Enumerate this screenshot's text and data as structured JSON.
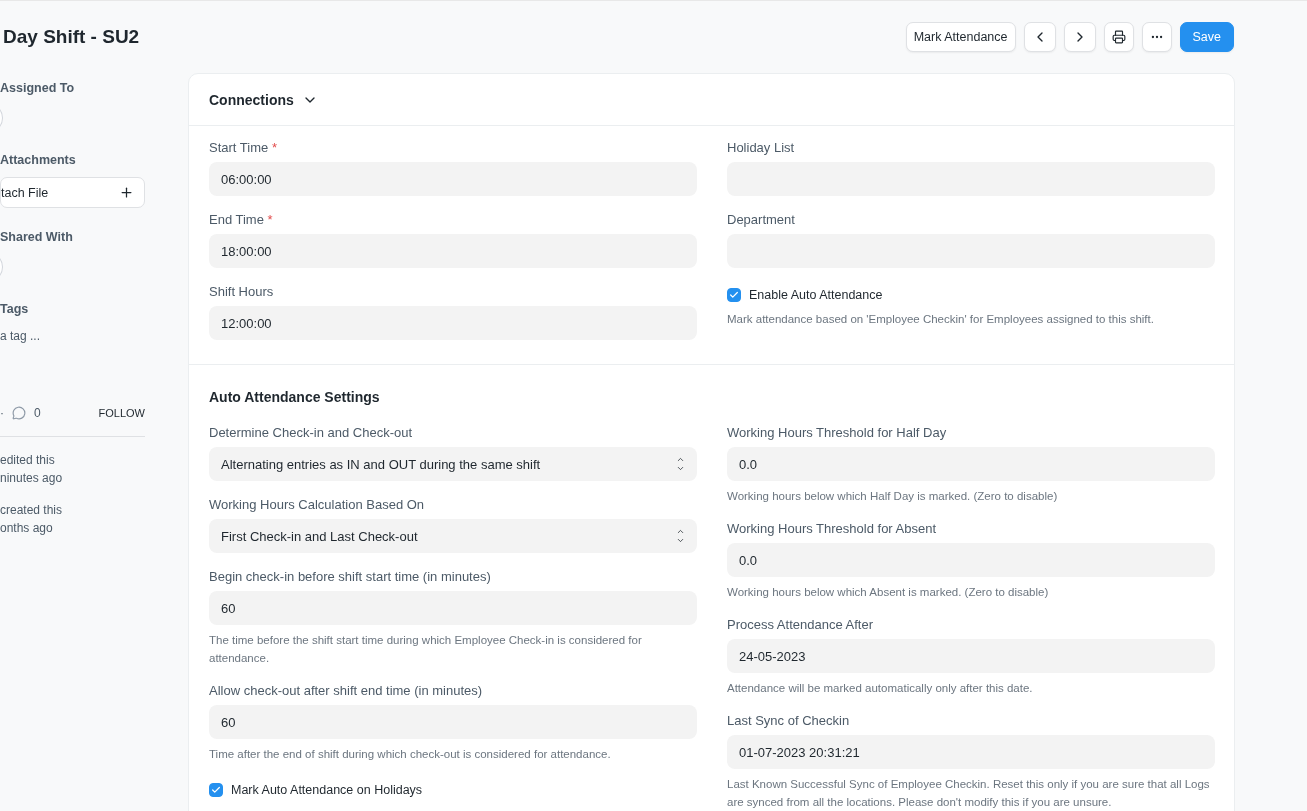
{
  "title": "Day Shift - SU2",
  "actions": {
    "mark": "Mark Attendance",
    "save": "Save"
  },
  "sidebar": {
    "sections": [
      {
        "label": "Assigned To",
        "kind": "avatar"
      },
      {
        "label": "Attachments",
        "kind": "attach",
        "button": "tach File"
      },
      {
        "label": "Shared With",
        "kind": "avatar"
      },
      {
        "label": "Tags",
        "kind": "tags",
        "placeholder": "a tag ..."
      }
    ],
    "dot": "·",
    "comments": "0",
    "follow": "FOLLOW",
    "activity": [
      {
        "line1": "edited this",
        "line2": "ninutes ago"
      },
      {
        "line1": "created this",
        "line2": "onths ago"
      }
    ]
  },
  "required_mark": "*",
  "connections": {
    "title": "Connections",
    "expanded": false
  },
  "sections": [
    {
      "columns": [
        [
          {
            "kind": "input",
            "label": "Start Time",
            "required": true,
            "value": "06:00:00"
          },
          {
            "kind": "input",
            "label": "End Time",
            "required": true,
            "value": "18:00:00"
          },
          {
            "kind": "input",
            "label": "Shift Hours",
            "required": false,
            "value": "12:00:00"
          }
        ],
        [
          {
            "kind": "input",
            "label": "Holiday List",
            "required": false
          },
          {
            "kind": "input",
            "label": "Department",
            "required": false
          },
          {
            "kind": "checkbox",
            "label": "Enable Auto Attendance",
            "checked": true,
            "description": "Mark attendance based on 'Employee Checkin' for Employees assigned to this shift."
          }
        ]
      ]
    },
    {
      "title": "Auto Attendance Settings",
      "columns": [
        [
          {
            "kind": "select",
            "label": "Determine Check-in and Check-out",
            "required": false,
            "value": "Alternating entries as IN and OUT during the same shift"
          },
          {
            "kind": "select",
            "label": "Working Hours Calculation Based On",
            "required": false,
            "value": "First Check-in and Last Check-out"
          },
          {
            "kind": "input",
            "label": "Begin check-in before shift start time (in minutes)",
            "required": false,
            "value": "60",
            "description": "The time before the shift start time during which Employee Check-in is considered for attendance."
          },
          {
            "kind": "input",
            "label": "Allow check-out after shift end time (in minutes)",
            "required": false,
            "value": "60",
            "description": "Time after the end of shift during which check-out is considered for attendance."
          },
          {
            "kind": "checkbox",
            "label": "Mark Auto Attendance on Holidays",
            "checked": true
          }
        ],
        [
          {
            "kind": "input",
            "label": "Working Hours Threshold for Half Day",
            "required": false,
            "value": "0.0",
            "description": "Working hours below which Half Day is marked. (Zero to disable)"
          },
          {
            "kind": "input",
            "label": "Working Hours Threshold for Absent",
            "required": false,
            "value": "0.0",
            "description": "Working hours below which Absent is marked. (Zero to disable)"
          },
          {
            "kind": "input",
            "label": "Process Attendance After",
            "required": false,
            "value": "24-05-2023",
            "description": "Attendance will be marked automatically only after this date."
          },
          {
            "kind": "input",
            "label": "Last Sync of Checkin",
            "required": false,
            "value": "01-07-2023 20:31:21",
            "description": "Last Known Successful Sync of Employee Checkin. Reset this only if you are sure that all Logs are synced from all the locations. Please don't modify this if you are unsure."
          }
        ]
      ]
    }
  ]
}
